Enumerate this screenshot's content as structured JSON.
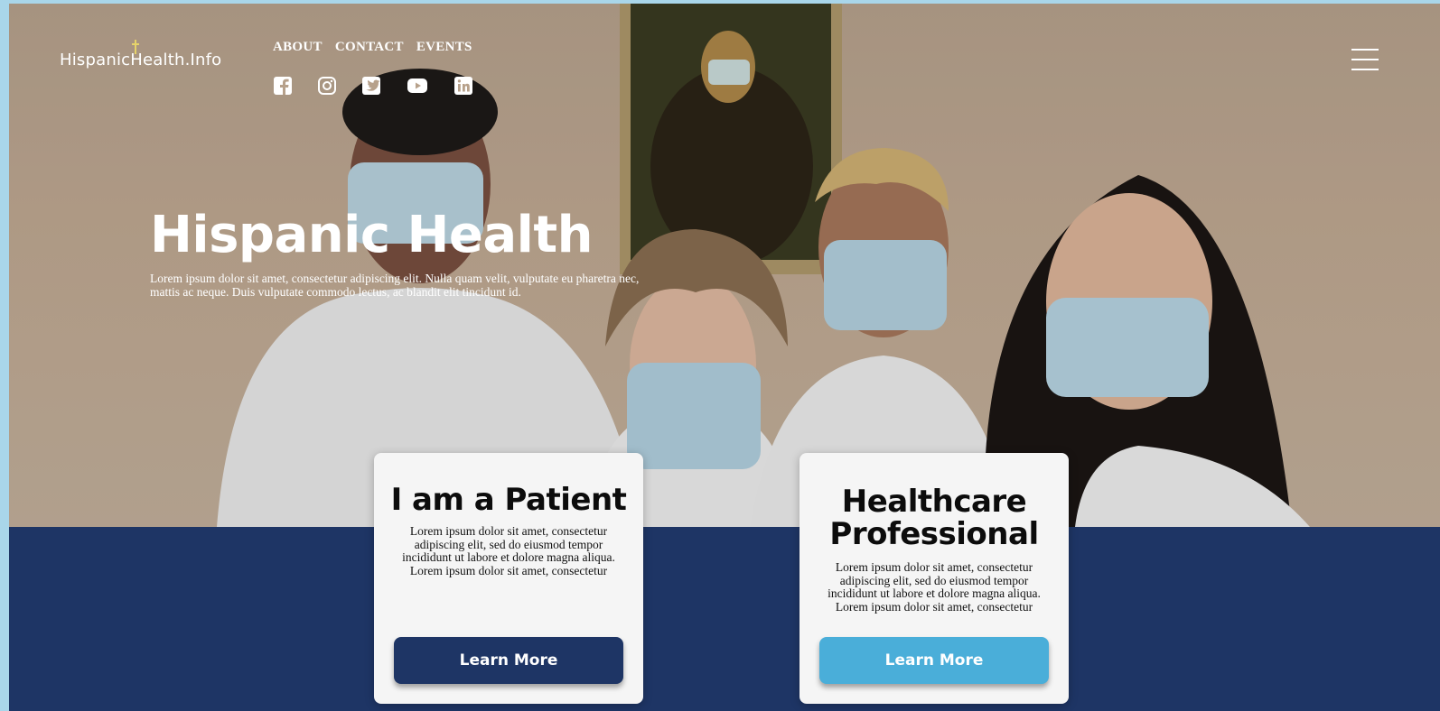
{
  "brand": {
    "logo_text": "HispanicHealth.Info"
  },
  "nav": {
    "items": [
      "ABOUT",
      "CONTACT",
      "EVENTS"
    ]
  },
  "social": [
    "facebook-icon",
    "instagram-icon",
    "twitter-icon",
    "youtube-icon",
    "linkedin-icon"
  ],
  "hero": {
    "title": "Hispanic Health",
    "text": "Lorem ipsum dolor sit amet, consectetur adipiscing elit. Nulla quam velit, vulputate eu pharetra nec, mattis ac neque. Duis vulputate commodo lectus, ac blandit elit tincidunt id."
  },
  "cards": [
    {
      "title": "I am a Patient",
      "text": "Lorem ipsum dolor sit amet, consectetur adipiscing elit, sed do eiusmod tempor incididunt ut labore et dolore magna aliqua. Lorem ipsum dolor sit amet, consectetur",
      "button": "Learn More"
    },
    {
      "title": "Healthcare Professional",
      "text": "Lorem ipsum dolor sit amet, consectetur adipiscing elit, sed do eiusmod tempor incididunt ut labore et dolore magna aliqua. Lorem ipsum dolor sit amet, consectetur",
      "button": "Learn More"
    }
  ],
  "colors": {
    "navy": "#1e3565",
    "sky": "#4aaed9",
    "page_border": "#a9d6ea"
  }
}
